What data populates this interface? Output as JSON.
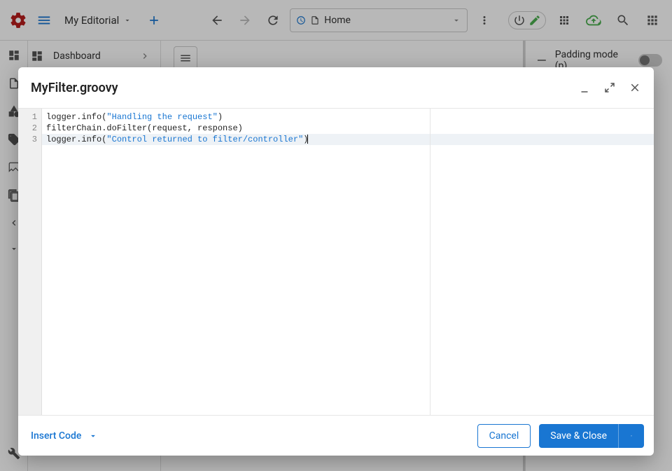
{
  "topbar": {
    "project": "My Editorial",
    "url_label": "Home"
  },
  "sidebar": {
    "items": [
      {
        "label": "Dashboard"
      }
    ]
  },
  "right_panel": {
    "padding_label": "Padding mode (p)"
  },
  "dialog": {
    "title": "MyFilter.groovy",
    "code": {
      "lines": [
        {
          "n": "1",
          "pre": "logger.info(",
          "str": "\"Handling the request\"",
          "post": ")"
        },
        {
          "n": "2",
          "pre": "filterChain.doFilter(request, response)",
          "str": "",
          "post": ""
        },
        {
          "n": "3",
          "pre": "logger.info(",
          "str": "\"Control returned to filter/controller\"",
          "post": ")"
        }
      ]
    },
    "footer": {
      "insert_code": "Insert Code",
      "cancel": "Cancel",
      "save_close": "Save & Close"
    }
  }
}
